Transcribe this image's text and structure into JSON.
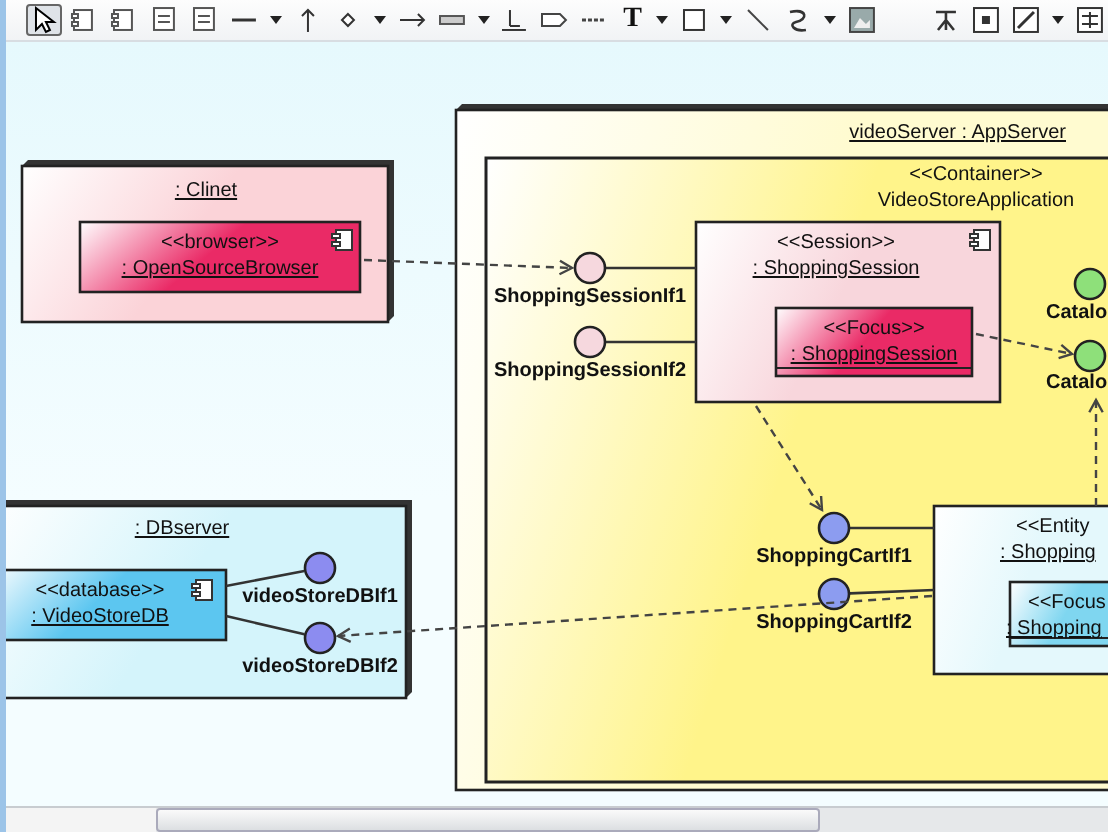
{
  "toolbar": [
    {
      "kind": "pointer",
      "selected": true
    },
    {
      "kind": "component",
      "selected": false
    },
    {
      "kind": "component",
      "selected": false
    },
    {
      "kind": "note",
      "selected": false
    },
    {
      "kind": "note",
      "selected": false
    },
    {
      "kind": "hline",
      "selected": false
    },
    {
      "kind": "dropdown",
      "selected": false
    },
    {
      "kind": "arrow-up",
      "selected": false
    },
    {
      "kind": "diamond",
      "selected": false
    },
    {
      "kind": "dropdown",
      "selected": false
    },
    {
      "kind": "arrow-right",
      "selected": false
    },
    {
      "kind": "bar",
      "selected": false
    },
    {
      "kind": "dropdown",
      "selected": false
    },
    {
      "kind": "baseline",
      "selected": false
    },
    {
      "kind": "tag",
      "selected": false
    },
    {
      "kind": "dash",
      "selected": false
    },
    {
      "kind": "text",
      "label": "T",
      "selected": false
    },
    {
      "kind": "dropdown",
      "selected": false
    },
    {
      "kind": "square",
      "selected": false
    },
    {
      "kind": "dropdown",
      "selected": false
    },
    {
      "kind": "diagonal",
      "selected": false
    },
    {
      "kind": "curve",
      "selected": false
    },
    {
      "kind": "dropdown",
      "selected": false
    },
    {
      "kind": "image",
      "selected": false
    },
    {
      "kind": "fork",
      "selected": false
    },
    {
      "kind": "dot-frame",
      "selected": false
    },
    {
      "kind": "line-style",
      "selected": false
    },
    {
      "kind": "dropdown",
      "selected": false
    },
    {
      "kind": "align",
      "selected": false
    }
  ],
  "diagram": {
    "nodes": [
      {
        "kind": "node",
        "name": ": Clinet",
        "color": "#fbd3d8"
      },
      {
        "kind": "node",
        "name": "videoServer : AppServer",
        "color": "#fffbd0"
      },
      {
        "kind": "container",
        "stereotype": "<<Container>>",
        "name": "VideoStoreApplication",
        "color": "#fff48a"
      },
      {
        "kind": "node",
        "name": ": DBserver",
        "color": "#d4f4fb"
      }
    ],
    "components": [
      {
        "kind": "component",
        "stereotype": "<<browser>>",
        "name": ": OpenSourceBrowser",
        "color": "#ea2a66"
      },
      {
        "kind": "component",
        "stereotype": "<<Session>>",
        "name": ": ShoppingSession",
        "color": "#f8d6dc"
      },
      {
        "kind": "part",
        "stereotype": "<<Focus>>",
        "name": ": ShoppingSession",
        "color": "#ea2a66"
      },
      {
        "kind": "plain",
        "stereotype": "<<Entity",
        "name": ": Shopping",
        "color": "#e4f8fc"
      },
      {
        "kind": "part",
        "stereotype": "<<Focus",
        "name": ": Shopping",
        "color": "#7fd6f0"
      },
      {
        "kind": "component",
        "stereotype": "<<database>>",
        "name": ": VideoStoreDB",
        "color": "#5cc6f0"
      }
    ],
    "interfaces": [
      {
        "label": "ShoppingSessionIf1",
        "color": "#f6d8de"
      },
      {
        "label": "ShoppingSessionIf2",
        "color": "#f6d8de"
      },
      {
        "label": "Catalo",
        "color": "#8ee07a"
      },
      {
        "label": "Catalo",
        "color": "#8ee07a"
      },
      {
        "label": "ShoppingCartIf1",
        "color": "#8c9cf0"
      },
      {
        "label": "ShoppingCartIf2",
        "color": "#8c9cf0"
      },
      {
        "label": "videoStoreDBIf1",
        "color": "#8c8cf0"
      },
      {
        "label": "videoStoreDBIf2",
        "color": "#8c8cf0"
      }
    ]
  }
}
